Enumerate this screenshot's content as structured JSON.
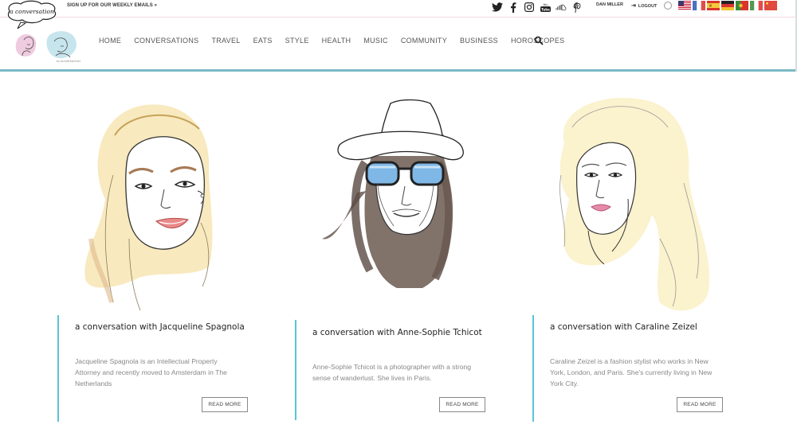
{
  "header": {
    "signup_text": "SIGN UP FOR OUR WEEKLY EMAILS »",
    "social_icons": [
      "twitter-icon",
      "facebook-icon",
      "instagram-icon",
      "youtube-icon",
      "soundcloud-icon",
      "pinterest-icon"
    ],
    "youtube_text": "You Tube",
    "user_name": "DAN MILLER",
    "logout_label": "LOGOUT",
    "logout_icon": "⇥",
    "flags": [
      "us-flag",
      "fr-flag",
      "es-flag",
      "de-flag",
      "pt-flag",
      "it-flag",
      "cn-flag"
    ],
    "accent_color": "#7ab9c6"
  },
  "logo": {
    "script_text": "a conversation",
    "byline": "by wunderkammer"
  },
  "nav": {
    "items": [
      "HOME",
      "CONVERSATIONS",
      "TRAVEL",
      "EATS",
      "STYLE",
      "HEALTH",
      "MUSIC",
      "COMMUNITY",
      "BUSINESS",
      "HOROSCOPES"
    ],
    "search_icon": "search-icon"
  },
  "cards": [
    {
      "title": "a conversation with Jacqueline Spagnola",
      "description_lines": [
        "Jacqueline Spagnola is an Intellectual Property",
        "Attorney and recently moved to Amsterdam in The",
        "Netherlands"
      ],
      "button_label": "READ MORE"
    },
    {
      "title": "a conversation with Anne-Sophie Tchicot",
      "description_lines": [
        "Anne-Sophie Tchicot is a photographer with a strong",
        "sense of wanderlust. She lives in Paris."
      ],
      "button_label": "READ MORE"
    },
    {
      "title": "a conversation with Caraline Zeizel",
      "description_lines": [
        "Caraline Zeizel is a fashion stylist who works in New",
        "York, London, and Paris. She's currently living in New",
        "York City."
      ],
      "button_label": "READ MORE"
    }
  ],
  "card_accent_color": "#5bc3d9"
}
